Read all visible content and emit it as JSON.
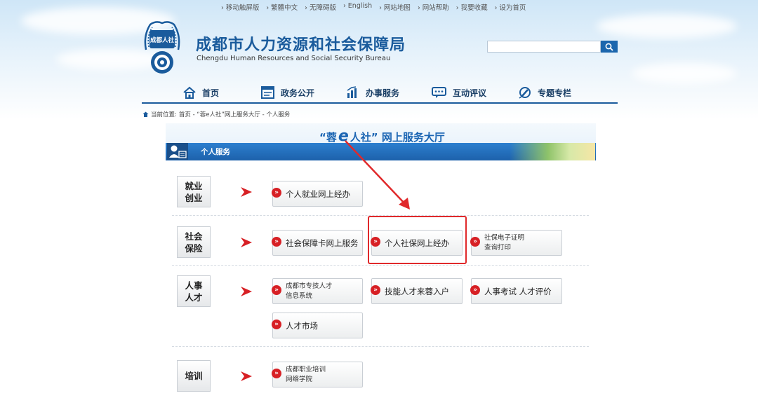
{
  "topbar": {
    "links": [
      "› 移动触屏版",
      "› 繁體中文",
      "› 无障碍版",
      "› English",
      "› 网站地图",
      "› 网站帮助",
      "› 我要收藏",
      "› 设为首页"
    ]
  },
  "header": {
    "logo_text": "成都人社",
    "title_cn": "成都市人力资源和社会保障局",
    "title_en": "Chengdu Human Resources and Social Security Bureau",
    "search_placeholder": ""
  },
  "nav": {
    "items": [
      {
        "label": "首页",
        "icon": "home-icon"
      },
      {
        "label": "政务公开",
        "icon": "document-icon"
      },
      {
        "label": "办事服务",
        "icon": "bar-chart-icon"
      },
      {
        "label": "互动评议",
        "icon": "chat-icon"
      },
      {
        "label": "专题专栏",
        "icon": "pen-icon"
      }
    ]
  },
  "breadcrumb": {
    "prefix": "当前位置:",
    "path": "首页 - “蓉e人社”网上服务大厅 - 个人服务"
  },
  "hall": {
    "title_a": "“蓉",
    "title_e": "e",
    "title_b": "人社” 网上服务大厅"
  },
  "section": {
    "title": "个人服务"
  },
  "categories": [
    {
      "line1": "就业",
      "line2": "创业"
    },
    {
      "line1": "社会",
      "line2": "保险"
    },
    {
      "line1": "人事",
      "line2": "人才"
    },
    {
      "line1": "培训",
      "line2": ""
    }
  ],
  "services": {
    "employment": "个人就业网上经办",
    "social_card": "社会保障卡网上服务",
    "personal_ss": "个人社保网上经办",
    "ss_certificate": "社保电子证明\n查询打印",
    "talent_system": "成都市专技人才\n信息系统",
    "skill_talent": "技能人才来蓉入户",
    "exam_eval": "人事考试 人才评价",
    "talent_market": "人才市场",
    "training_college": "成都职业培训\n网络学院"
  },
  "colors": {
    "accent": "#1a5b9c",
    "highlight": "#e0292b",
    "bullet": "#d72025"
  }
}
